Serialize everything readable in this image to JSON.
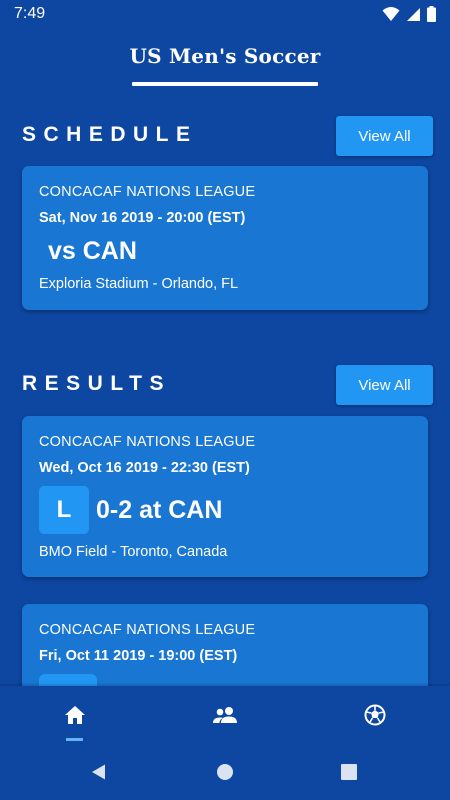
{
  "status_bar": {
    "time": "7:49",
    "icons": [
      "wifi-icon",
      "signal-icon",
      "battery-icon"
    ]
  },
  "app": {
    "title": "US Men's Soccer"
  },
  "schedule": {
    "title": "SCHEDULE",
    "view_all_label": "View All",
    "matches": [
      {
        "league": "CONCACAF NATIONS LEAGUE",
        "datetime": "Sat, Nov 16 2019 - 20:00 (EST)",
        "opponent": "vs CAN",
        "venue": "Exploria Stadium - Orlando, FL"
      }
    ]
  },
  "results": {
    "title": "RESULTS",
    "view_all_label": "View All",
    "matches": [
      {
        "league": "CONCACAF NATIONS LEAGUE",
        "datetime": "Wed, Oct 16 2019 - 22:30 (EST)",
        "outcome": "L",
        "score": "0-2 at CAN",
        "venue": "BMO Field - Toronto, Canada"
      },
      {
        "league": "CONCACAF NATIONS LEAGUE",
        "datetime": "Fri, Oct 11 2019 - 19:00 (EST)"
      }
    ]
  },
  "bottom_nav": {
    "items": [
      {
        "icon": "home-icon",
        "active": true
      },
      {
        "icon": "players-icon",
        "active": false
      },
      {
        "icon": "soccer-ball-icon",
        "active": false
      }
    ]
  },
  "system_nav": {
    "buttons": [
      "back-icon",
      "home-circle-icon",
      "recents-icon"
    ]
  },
  "colors": {
    "background": "#0d47a1",
    "card": "#1976d2",
    "accent": "#2196f3",
    "text": "#ffffff"
  }
}
